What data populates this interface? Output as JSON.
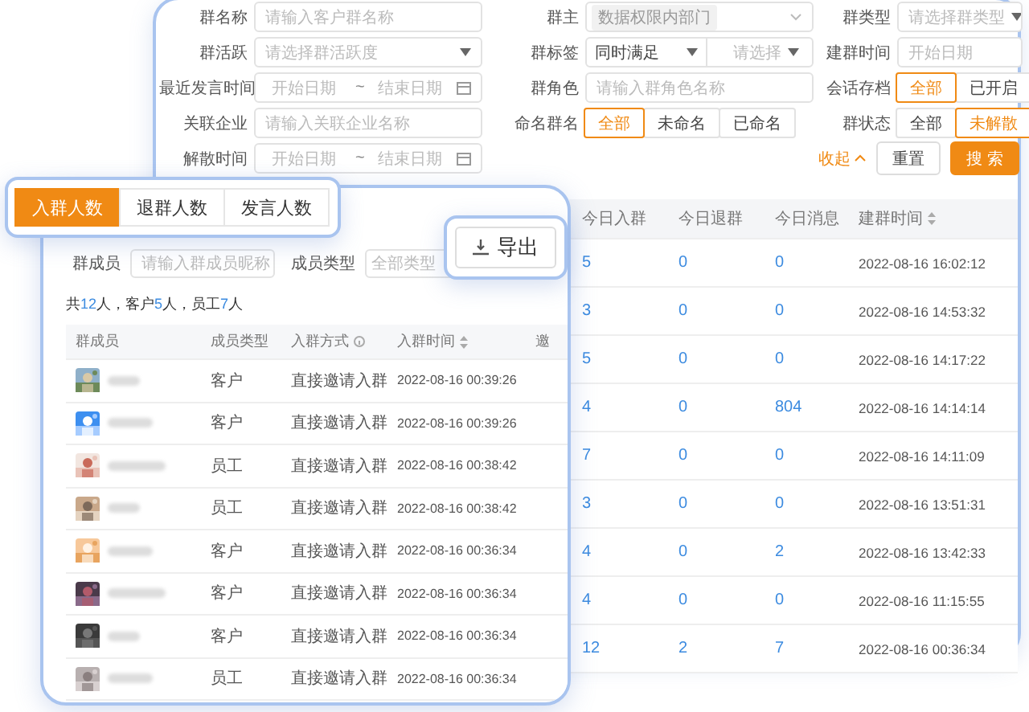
{
  "filters": [
    {
      "cells": [
        {
          "label": "群名称",
          "kind": "input",
          "placeholder": "请输入客户群名称"
        },
        {
          "label": "群主",
          "kind": "tagselect",
          "tag": "数据权限内部门"
        },
        {
          "label": "群类型",
          "kind": "select",
          "placeholder": "请选择群类型"
        }
      ]
    },
    {
      "cells": [
        {
          "label": "群活跃",
          "kind": "select",
          "placeholder": "请选择群活跃度"
        },
        {
          "label": "群标签",
          "kind": "dualselect",
          "value": "同时满足",
          "placeholder": "请选择"
        },
        {
          "label": "建群时间",
          "kind": "date",
          "placeholder": "开始日期"
        }
      ]
    },
    {
      "cells": [
        {
          "label": "最近发言时间",
          "kind": "daterange",
          "start": "开始日期",
          "sep": "~",
          "end": "结束日期"
        },
        {
          "label": "群角色",
          "kind": "input",
          "placeholder": "请输入群角色名称"
        },
        {
          "label": "会话存档",
          "kind": "segmented",
          "options": [
            {
              "label": "全部",
              "selected": true
            },
            {
              "label": "已开启",
              "selected": false
            }
          ]
        }
      ]
    },
    {
      "cells": [
        {
          "label": "关联企业",
          "kind": "input",
          "placeholder": "请输入关联企业名称"
        },
        {
          "label": "命名群名",
          "kind": "segmented",
          "options": [
            {
              "label": "全部",
              "selected": true
            },
            {
              "label": "未命名",
              "selected": false
            },
            {
              "label": "已命名",
              "selected": false
            }
          ]
        },
        {
          "label": "群状态",
          "kind": "segmented",
          "options": [
            {
              "label": "全部",
              "selected": false
            },
            {
              "label": "未解散",
              "selected": true
            }
          ]
        }
      ]
    },
    {
      "cells": [
        {
          "label": "解散时间",
          "kind": "daterange",
          "start": "开始日期",
          "sep": "~",
          "end": "结束日期"
        },
        {
          "kind": "actions",
          "collapse": "收起",
          "reset": "重置",
          "search": "搜 索"
        }
      ]
    }
  ],
  "group_table": {
    "columns": [
      "今日入群",
      "今日退群",
      "今日消息",
      "建群时间"
    ],
    "rows": [
      [
        "5",
        "0",
        "0",
        "2022-08-16 16:02:12"
      ],
      [
        "3",
        "0",
        "0",
        "2022-08-16 14:53:32"
      ],
      [
        "5",
        "0",
        "0",
        "2022-08-16 14:17:22"
      ],
      [
        "4",
        "0",
        "804",
        "2022-08-16 14:14:14"
      ],
      [
        "7",
        "0",
        "0",
        "2022-08-16 14:11:09"
      ],
      [
        "3",
        "0",
        "0",
        "2022-08-16 13:51:31"
      ],
      [
        "4",
        "0",
        "2",
        "2022-08-16 13:42:33"
      ],
      [
        "4",
        "0",
        "0",
        "2022-08-16 11:15:55"
      ],
      [
        "12",
        "2",
        "7",
        "2022-08-16 00:36:34"
      ]
    ]
  },
  "tabs": [
    {
      "label": "入群人数",
      "selected": true
    },
    {
      "label": "退群人数",
      "selected": false
    },
    {
      "label": "发言人数",
      "selected": false
    }
  ],
  "export_button": {
    "label": "导出"
  },
  "member_panel": {
    "member_filter": {
      "label": "群成员",
      "placeholder": "请输入群成员昵称"
    },
    "type_filter": {
      "label": "成员类型",
      "placeholder": "全部类型"
    },
    "summary": "共**12**人，客户**5**人，员工**7**人",
    "columns": [
      "群成员",
      "成员类型",
      "入群方式",
      "入群时间",
      "邀"
    ],
    "rows": [
      {
        "type": "客户",
        "method": "直接邀请入群",
        "time": "2022-08-16 00:39:26"
      },
      {
        "type": "客户",
        "method": "直接邀请入群",
        "time": "2022-08-16 00:39:26"
      },
      {
        "type": "员工",
        "method": "直接邀请入群",
        "time": "2022-08-16 00:38:42"
      },
      {
        "type": "员工",
        "method": "直接邀请入群",
        "time": "2022-08-16 00:38:42"
      },
      {
        "type": "客户",
        "method": "直接邀请入群",
        "time": "2022-08-16 00:36:34"
      },
      {
        "type": "客户",
        "method": "直接邀请入群",
        "time": "2022-08-16 00:36:34"
      },
      {
        "type": "客户",
        "method": "直接邀请入群",
        "time": "2022-08-16 00:36:34"
      },
      {
        "type": "员工",
        "method": "直接邀请入群",
        "time": "2022-08-16 00:36:34"
      }
    ]
  }
}
